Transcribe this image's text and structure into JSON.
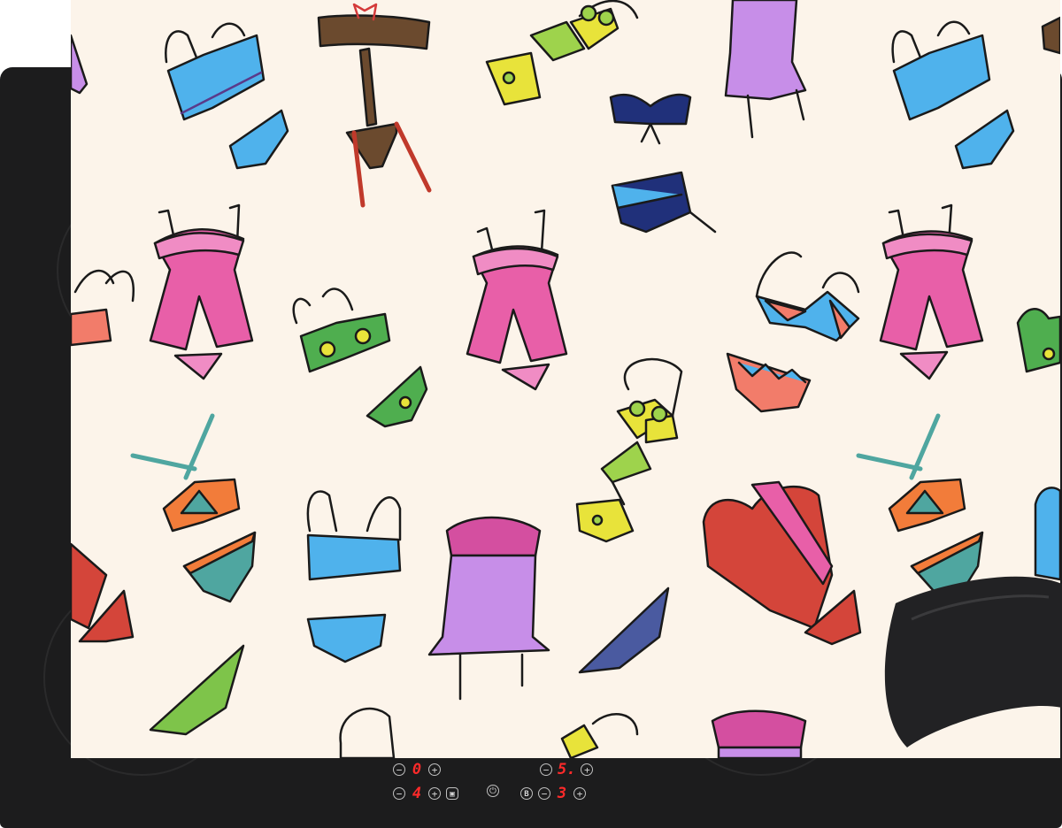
{
  "colors": {
    "stovetop": "#1c1c1d",
    "cover_background": "#fcf4ea",
    "display_digits": "#ff2a2a",
    "controls": "#d6d6d6"
  },
  "cover": {
    "pattern_icons": [
      "camisole-icon",
      "bra-icon",
      "panties-icon",
      "corset-icon",
      "garter-belt-icon",
      "bikini-icon",
      "thong-icon",
      "bustier-icon"
    ]
  },
  "control_panel": {
    "zone_left_top": {
      "minus": "−",
      "value": "0",
      "plus": "+"
    },
    "zone_right_top": {
      "minus": "−",
      "value": "5.",
      "plus": "+"
    },
    "zone_left_bottom": {
      "minus": "−",
      "value": "4",
      "plus": "+"
    },
    "zone_right_bottom": {
      "boost": "B",
      "minus": "−",
      "value": "3",
      "plus": "+"
    },
    "lock_icon": "lock-icon",
    "power_icon": "power-icon"
  }
}
